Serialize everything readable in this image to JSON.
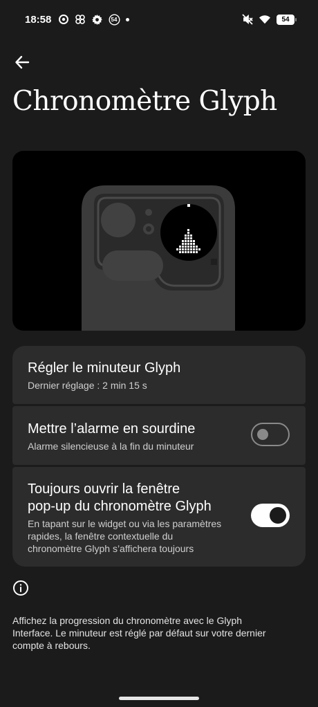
{
  "status_bar": {
    "time": "18:58",
    "left_icons": [
      "chrome-icon",
      "pinwheel-icon",
      "gear-icon",
      "badge-54-icon",
      "dot-icon"
    ],
    "left_badge": "54",
    "right_icons": [
      "mute-icon",
      "wifi-icon",
      "battery-icon"
    ],
    "battery_level": "54"
  },
  "header": {
    "back_icon": "arrow-left-icon",
    "title": "Chronomètre Glyph"
  },
  "settings": {
    "timer": {
      "title": "Régler le minuteur Glyph",
      "subtitle": "Dernier réglage : 2 min 15 s"
    },
    "mute_alarm": {
      "title": "Mettre l’alarme en sourdine",
      "subtitle": "Alarme silencieuse à la fin du minuteur",
      "enabled": false
    },
    "always_popup": {
      "title_line1": "Toujours ouvrir la fenêtre",
      "title_line2": "pop-up du chronomètre Glyph",
      "subtitle_line1": "En tapant sur le widget ou via les paramètres",
      "subtitle_line2": "rapides, la fenêtre contextuelle du",
      "subtitle_line3": "chronomètre Glyph s’affichera toujours",
      "enabled": true
    }
  },
  "info": {
    "icon": "info-icon",
    "text_line1": "Affichez la progression du chronomètre avec le Glyph",
    "text_line2": "Interface. Le minuteur est réglé par défaut sur votre dernier",
    "text_line3": "compte à rebours."
  },
  "colors": {
    "background": "#1b1b1b",
    "card": "#2c2c2c",
    "preview_bg": "#000000"
  }
}
